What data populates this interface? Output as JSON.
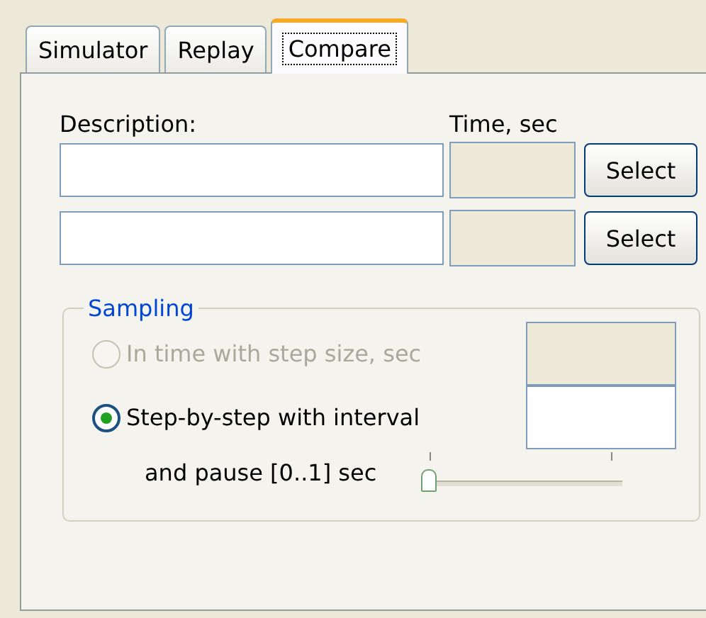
{
  "tabs": [
    {
      "label": "Simulator",
      "selected": false
    },
    {
      "label": "Replay",
      "selected": false
    },
    {
      "label": "Compare",
      "selected": true
    }
  ],
  "columns": {
    "description": "Description:",
    "time": "Time, sec"
  },
  "rows": [
    {
      "button": "Select",
      "time_disabled": true
    },
    {
      "button": "Select",
      "time_disabled": true
    }
  ],
  "sampling": {
    "legend": "Sampling",
    "options": [
      {
        "label": "In time with step size, sec",
        "selected": false,
        "disabled": true,
        "field_disabled": true
      },
      {
        "label": "Step-by-step with interval",
        "selected": true,
        "disabled": false,
        "field_disabled": false
      }
    ],
    "pause": {
      "label": "and pause [0..1] sec",
      "level": 0
    }
  }
}
